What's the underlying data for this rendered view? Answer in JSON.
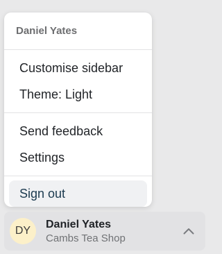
{
  "account_menu": {
    "header_name": "Daniel Yates",
    "groups": [
      [
        "Customise sidebar",
        "Theme: Light"
      ],
      [
        "Send feedback",
        "Settings"
      ],
      [
        "Sign out"
      ]
    ]
  },
  "account_bar": {
    "avatar_initials": "DY",
    "name": "Daniel Yates",
    "shop": "Cambs Tea Shop",
    "chevron_icon": "chevron-up-icon"
  },
  "colors": {
    "background": "#e9e9ea",
    "menu_bg": "#ffffff",
    "avatar_bg": "#fcf0c9",
    "selected_item_bg": "#f0f1f3"
  }
}
